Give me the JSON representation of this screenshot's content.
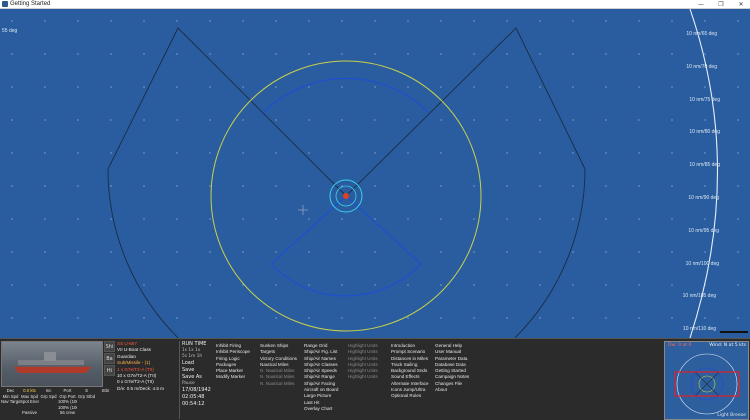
{
  "window": {
    "title": "Getting Started",
    "minimize": "—",
    "maximize": "❐",
    "close": "✕"
  },
  "map": {
    "top_left_label": "55 deg",
    "range_labels": [
      "10 nm/65 deg",
      "10 nm/70 deg",
      "10 nm/75 deg",
      "10 nm/80 deg",
      "10 nm/85 deg",
      "10 nm/90 deg",
      "10 nm/95 deg",
      "10 nm/100 deg",
      "10 nm/105 deg",
      "10 nm/110 deg"
    ],
    "colors": {
      "sea": "#295d9f",
      "range_ring": "#c8d24a",
      "arc": "#1d4fd0",
      "sector": "#1c2c44"
    }
  },
  "ship": {
    "name": "SS U-587",
    "class": "VII U-Boat Class",
    "status": "Guardian",
    "line3": "Sub/Missile - (1)",
    "line4": "",
    "weapon1": "1 x G7e/T2-A (TII)",
    "weapon2": "10 x G7e/T2-A (TII)",
    "weapon3": "0 x G7e/T2-A (TII)",
    "depth": "D/e: 0.5 m/Deck: 4.5 m",
    "side_tabs": [
      "Shi",
      "Ba",
      "Hi"
    ]
  },
  "control_grid": {
    "rows": [
      [
        "Dec",
        "0.0 kts",
        "Inc",
        "Port",
        "S",
        "Stbr"
      ],
      [
        "Min Spd",
        "Max Spd",
        "Grp Spd",
        "Grp Port",
        "Grp Stbd",
        ""
      ],
      [
        "Nav Target",
        "Spot Enemy",
        "",
        "100% (100.0%)",
        "",
        ""
      ],
      [
        "",
        "",
        "",
        "100% (100.0%)",
        "",
        ""
      ],
      [
        "",
        "Passive",
        "",
        "56 crew",
        "",
        ""
      ]
    ]
  },
  "run_time": {
    "header": "RUN TIME",
    "speeds": "1s  1x  1x",
    "speed2": "5s  1m  1h",
    "load": "Load",
    "save": "Save",
    "save_as": "Save As",
    "pause": "Pause",
    "date": "17/08/1942",
    "time1": "02:05:48",
    "time2": "00:54:12"
  },
  "menus": {
    "col1": [
      "Inhibit Firing",
      "Inhibit Periscope",
      "Firing Logic",
      "Packages",
      "Place Marker",
      "Modify Marker"
    ],
    "col2": [
      "Sunken Ships",
      "Targets",
      "Victory Conditions",
      "Nautical Miles",
      "N. Nautical Miles",
      "N. Nautical Miles",
      "N. Nautical Miles"
    ],
    "col3": [
      "Range Grid",
      "Ship/Air Fig. List",
      "Ship/Air Names",
      "Ship/Air Classes",
      "Ship/Air Speeds",
      "Ship/Air Range",
      "Ship/Air Facing",
      "Aircraft on Board",
      "Large Picture",
      "Last Hit",
      "Overlay Chart"
    ],
    "col4": [
      "Highlight Units",
      "Highlight Units",
      "Highlight Units",
      "Highlight Units",
      "Highlight Units",
      "Highlight Units"
    ],
    "col5": [
      "Introduction",
      "Prompt Scenario",
      "Distances in Miles",
      "Track Sailing",
      "Background Snds",
      "Sound Effects",
      "Alternate Interface",
      "Icons Jump/Ultra",
      "Optional Rules"
    ],
    "col6": [
      "General Help",
      "User Manual",
      "Parameter Data",
      "Database Data",
      "Getting Started",
      "Campaign Notes",
      "Changes File",
      "About"
    ]
  },
  "minimap": {
    "wind": "Dw: 0 at 0",
    "wind_right": "Wind: N at 5 kts",
    "footer": "Light Breeze"
  }
}
